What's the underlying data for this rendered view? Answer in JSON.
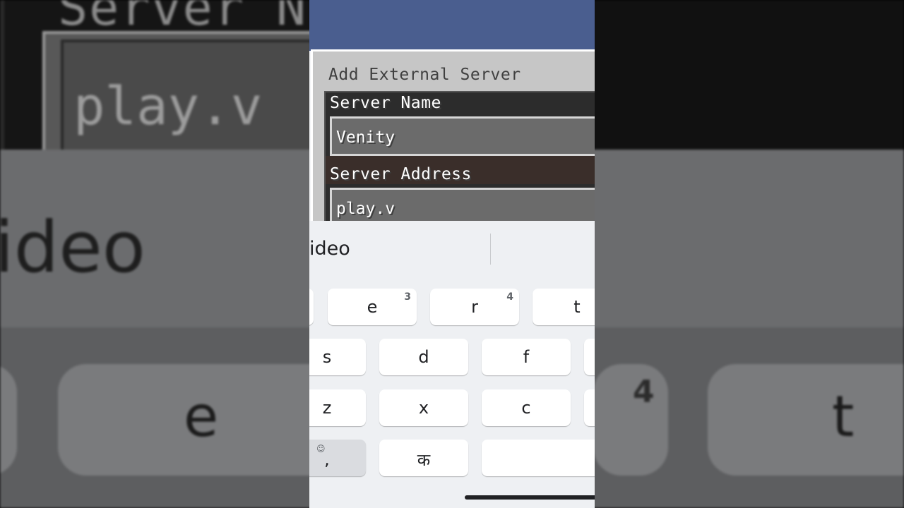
{
  "dialog": {
    "title": "Add External Server",
    "server_name_label": "Server Name",
    "server_name_value": "Venity",
    "server_address_label": "Server Address",
    "server_address_value": "play.v"
  },
  "keyboard": {
    "suggestion": "ideo",
    "row1": [
      {
        "label": "e",
        "num": "3"
      },
      {
        "label": "r",
        "num": "4"
      },
      {
        "label": "t",
        "num": ""
      }
    ],
    "row2": [
      "s",
      "d",
      "f"
    ],
    "row3": [
      "z",
      "x",
      "c"
    ],
    "comma_key": ",",
    "hindi_key": "क"
  },
  "background": {
    "big_label": "Server N",
    "big_input": "play.v",
    "big_word": "ideo",
    "big_key_e": "e",
    "big_key_t": "t",
    "big_num": "4"
  },
  "colors": {
    "sky": "#4a5e8f",
    "dialog_bg": "#c6c6c6",
    "input_bg": "#6b6b6b",
    "keyboard_bg": "#eef0f3"
  }
}
